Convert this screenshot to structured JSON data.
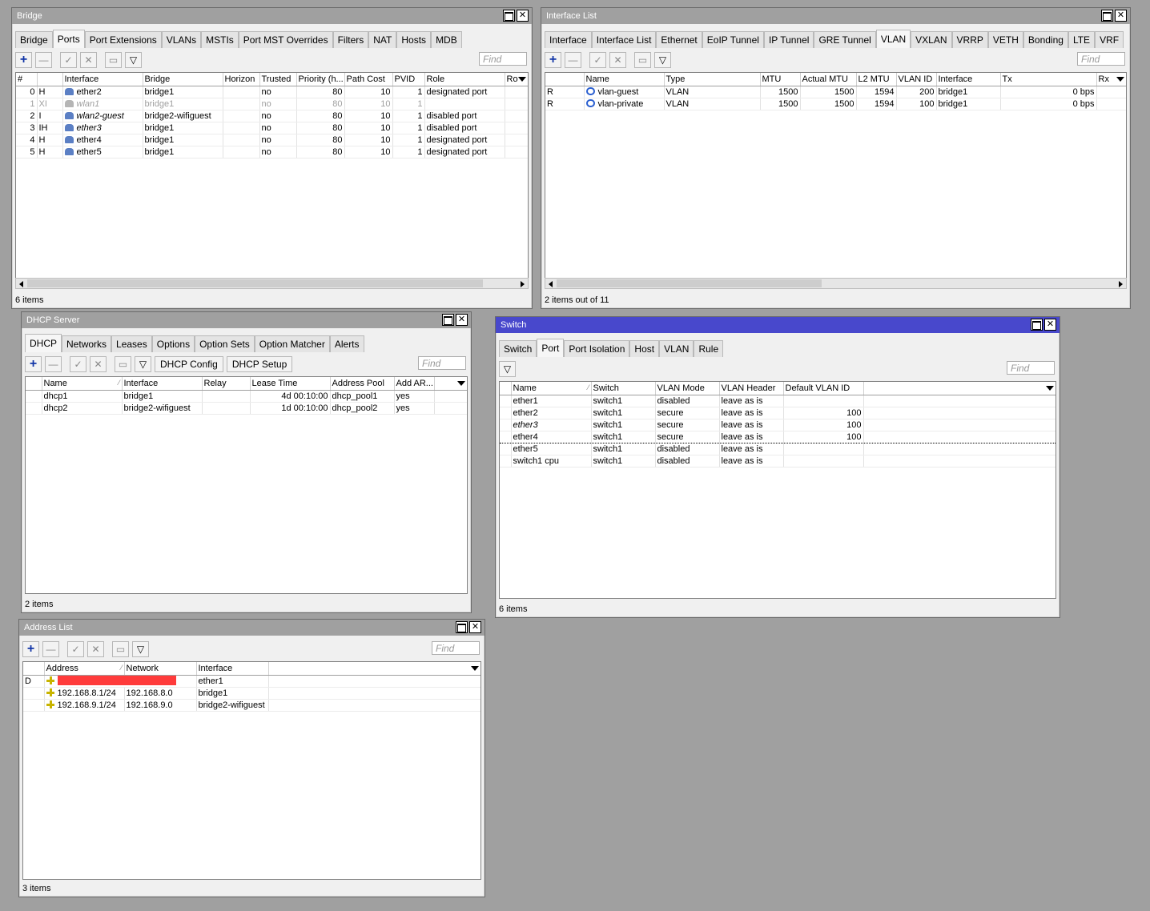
{
  "bridge": {
    "title": "Bridge",
    "tabs": [
      "Bridge",
      "Ports",
      "Port Extensions",
      "VLANs",
      "MSTIs",
      "Port MST Overrides",
      "Filters",
      "NAT",
      "Hosts",
      "MDB"
    ],
    "find_placeholder": "Find",
    "columns": [
      "#",
      "",
      "Interface",
      "Bridge",
      "Horizon",
      "Trusted",
      "Priority (h...",
      "Path Cost",
      "PVID",
      "Role",
      "Ro"
    ],
    "rows": [
      {
        "n": "0",
        "flag": "H",
        "iface": "ether2",
        "bridge": "bridge1",
        "horizon": "",
        "trusted": "no",
        "prio": "80",
        "cost": "10",
        "pvid": "1",
        "role": "designated port"
      },
      {
        "n": "1",
        "flag": "XI",
        "iface": "wlan1",
        "bridge": "bridge1",
        "horizon": "",
        "trusted": "no",
        "prio": "80",
        "cost": "10",
        "pvid": "1",
        "role": ""
      },
      {
        "n": "2",
        "flag": "I",
        "iface": "wlan2-guest",
        "bridge": "bridge2-wifiguest",
        "horizon": "",
        "trusted": "no",
        "prio": "80",
        "cost": "10",
        "pvid": "1",
        "role": "disabled port"
      },
      {
        "n": "3",
        "flag": "IH",
        "iface": "ether3",
        "bridge": "bridge1",
        "horizon": "",
        "trusted": "no",
        "prio": "80",
        "cost": "10",
        "pvid": "1",
        "role": "disabled port"
      },
      {
        "n": "4",
        "flag": "H",
        "iface": "ether4",
        "bridge": "bridge1",
        "horizon": "",
        "trusted": "no",
        "prio": "80",
        "cost": "10",
        "pvid": "1",
        "role": "designated port"
      },
      {
        "n": "5",
        "flag": "H",
        "iface": "ether5",
        "bridge": "bridge1",
        "horizon": "",
        "trusted": "no",
        "prio": "80",
        "cost": "10",
        "pvid": "1",
        "role": "designated port"
      }
    ],
    "status": "6 items"
  },
  "iflist": {
    "title": "Interface List",
    "tabs": [
      "Interface",
      "Interface List",
      "Ethernet",
      "EoIP Tunnel",
      "IP Tunnel",
      "GRE Tunnel",
      "VLAN",
      "VXLAN",
      "VRRP",
      "VETH",
      "Bonding",
      "LTE",
      "VRF"
    ],
    "find_placeholder": "Find",
    "columns": [
      "",
      "Name",
      "Type",
      "MTU",
      "Actual MTU",
      "L2 MTU",
      "VLAN ID",
      "Interface",
      "Tx",
      "Rx"
    ],
    "rows": [
      {
        "flag": "R",
        "name": "vlan-guest",
        "type": "VLAN",
        "mtu": "1500",
        "amtu": "1500",
        "l2mtu": "1594",
        "vid": "200",
        "iface": "bridge1",
        "tx": "0 bps"
      },
      {
        "flag": "R",
        "name": "vlan-private",
        "type": "VLAN",
        "mtu": "1500",
        "amtu": "1500",
        "l2mtu": "1594",
        "vid": "100",
        "iface": "bridge1",
        "tx": "0 bps"
      }
    ],
    "status": "2 items out of 11"
  },
  "dhcp": {
    "title": "DHCP Server",
    "tabs": [
      "DHCP",
      "Networks",
      "Leases",
      "Options",
      "Option Sets",
      "Option Matcher",
      "Alerts"
    ],
    "config_btn": "DHCP Config",
    "setup_btn": "DHCP Setup",
    "find_placeholder": "Find",
    "columns": [
      "Name",
      "Interface",
      "Relay",
      "Lease Time",
      "Address Pool",
      "Add AR..."
    ],
    "rows": [
      {
        "name": "dhcp1",
        "iface": "bridge1",
        "relay": "",
        "lease": "4d 00:10:00",
        "pool": "dhcp_pool1",
        "addarp": "yes"
      },
      {
        "name": "dhcp2",
        "iface": "bridge2-wifiguest",
        "relay": "",
        "lease": "1d 00:10:00",
        "pool": "dhcp_pool2",
        "addarp": "yes"
      }
    ],
    "status": "2 items"
  },
  "switch": {
    "title": "Switch",
    "tabs": [
      "Switch",
      "Port",
      "Port Isolation",
      "Host",
      "VLAN",
      "Rule"
    ],
    "find_placeholder": "Find",
    "columns": [
      "Name",
      "Switch",
      "VLAN Mode",
      "VLAN Header",
      "Default VLAN ID"
    ],
    "rows": [
      {
        "name": "ether1",
        "sw": "switch1",
        "mode": "disabled",
        "header": "leave as is",
        "dvid": ""
      },
      {
        "name": "ether2",
        "sw": "switch1",
        "mode": "secure",
        "header": "leave as is",
        "dvid": "100"
      },
      {
        "name": "ether3",
        "sw": "switch1",
        "mode": "secure",
        "header": "leave as is",
        "dvid": "100"
      },
      {
        "name": "ether4",
        "sw": "switch1",
        "mode": "secure",
        "header": "leave as is",
        "dvid": "100"
      },
      {
        "name": "ether5",
        "sw": "switch1",
        "mode": "disabled",
        "header": "leave as is",
        "dvid": ""
      },
      {
        "name": "switch1 cpu",
        "sw": "switch1",
        "mode": "disabled",
        "header": "leave as is",
        "dvid": ""
      }
    ],
    "status": "6 items"
  },
  "addrlist": {
    "title": "Address List",
    "find_placeholder": "Find",
    "columns": [
      "Address",
      "Network",
      "Interface"
    ],
    "rows": [
      {
        "flag": "D",
        "addr": "",
        "net": "",
        "iface": "ether1"
      },
      {
        "flag": "",
        "addr": "192.168.8.1/24",
        "net": "192.168.8.0",
        "iface": "bridge1"
      },
      {
        "flag": "",
        "addr": "192.168.9.1/24",
        "net": "192.168.9.0",
        "iface": "bridge2-wifiguest"
      }
    ],
    "status": "3 items"
  },
  "colors": {
    "active_title": "#4848cc",
    "inactive_title": "#a0a0a0",
    "redaction": "#ff3b3b"
  }
}
